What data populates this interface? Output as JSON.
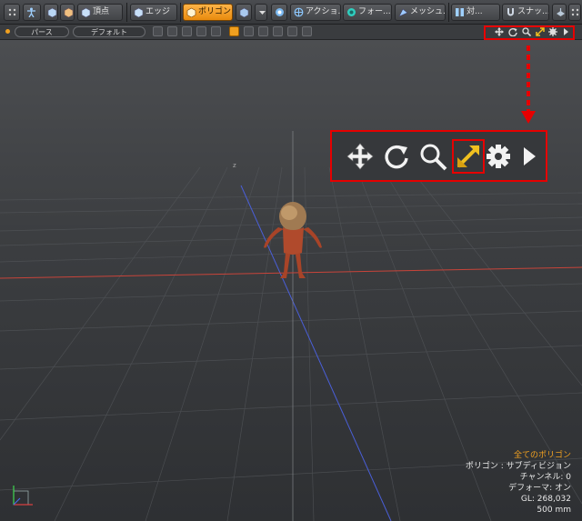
{
  "toolbar": {
    "vertex_label": "頂点",
    "edge_label": "エッジ",
    "polygon_label": "ポリゴン",
    "action_label": "アクショ...",
    "falloff_label": "フォー...",
    "mesh_label": "メッシュ...",
    "symmetry_label": "対...",
    "snap_label": "スナッ...",
    "accent_color": "#f0a020"
  },
  "viewport_bar": {
    "projection": "パース",
    "style": "デフォルト"
  },
  "stats": {
    "line1": "全てのポリゴン",
    "line2": "ポリゴン : サブディビジョン",
    "line3": "チャンネル: 0",
    "line4": "デフォーマ: オン",
    "line5": "GL: 268,032",
    "line6": "500 mm"
  },
  "annotation": {
    "highlight_color": "#e60000",
    "highlighted_tool": "zoom-extent-icon"
  }
}
